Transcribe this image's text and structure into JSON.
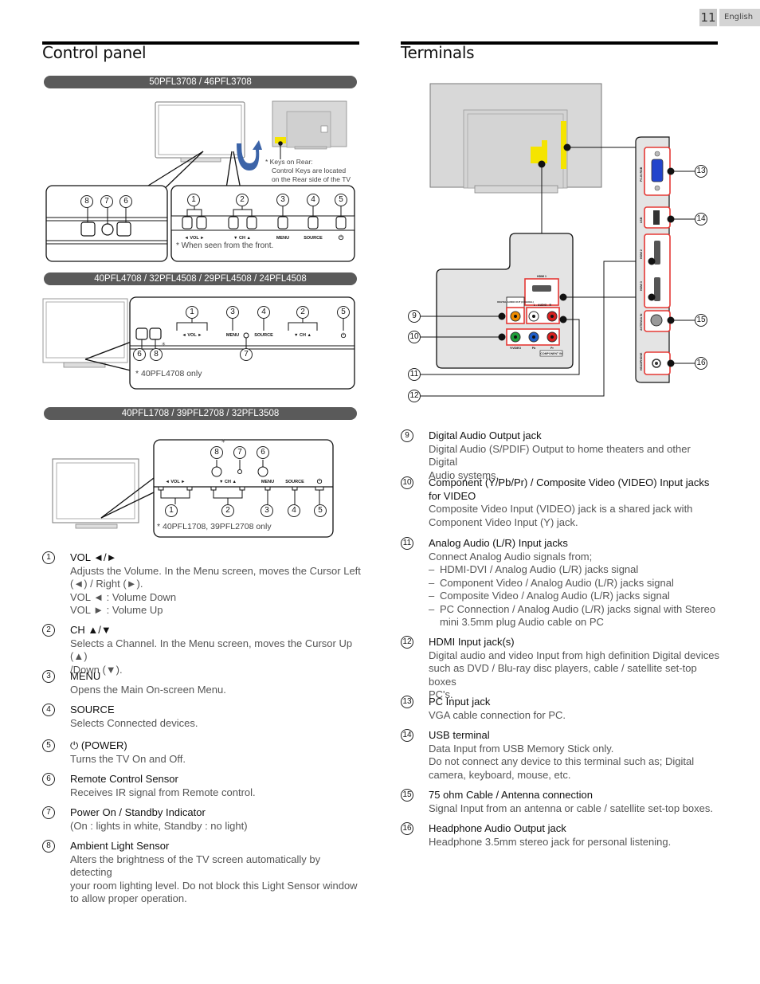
{
  "page": {
    "number": "11",
    "language": "English"
  },
  "control_panel": {
    "title": "Control panel",
    "models": [
      {
        "name": "50PFL3708 / 46PFL3708",
        "rear_note_title": "* Keys on Rear:",
        "rear_note_lines": [
          "Control Keys are located",
          "on the Rear side of the TV"
        ],
        "front_note": "* When seen from the front.",
        "button_labels": [
          "◄  VOL  ►",
          "▼  CH  ▲",
          "MENU",
          "SOURCE",
          "⏻"
        ],
        "callouts_left": [
          "8",
          "7",
          "6"
        ],
        "callouts_right": [
          "1",
          "2",
          "3",
          "4",
          "5"
        ]
      },
      {
        "name": "40PFL4708 / 32PFL4508 / 29PFL4508 / 24PFL4508",
        "note": "* 40PFL4708 only",
        "button_labels": [
          "◄  VOL  ►",
          "MENU",
          "SOURCE",
          "▼  CH  ▲",
          "⏻"
        ],
        "callouts_top": [
          "1",
          "3",
          "4",
          "2",
          "5"
        ],
        "callouts_bottom": [
          "6",
          "8",
          "7"
        ]
      },
      {
        "name": "40PFL1708 / 39PFL2708 / 32PFL3508",
        "note": "* 40PFL1708, 39PFL2708 only",
        "button_labels": [
          "◄  VOL  ►",
          "▼  CH  ▲",
          "MENU",
          "SOURCE",
          "⏻"
        ],
        "callouts_top": [
          "8",
          "7",
          "6"
        ],
        "callouts_bottom": [
          "1",
          "2",
          "3",
          "4",
          "5"
        ]
      }
    ],
    "items": [
      {
        "num": "1",
        "title": "VOL ◄/►",
        "lines": [
          "Adjusts the Volume. In the Menu screen, moves the Cursor Left",
          "(◄) / Right (►).",
          "VOL ◄ :  Volume Down",
          "VOL ► :  Volume Up"
        ]
      },
      {
        "num": "2",
        "title": "CH ▲/▼",
        "lines": [
          "Selects a Channel. In the Menu screen, moves the Cursor Up (▲)",
          "/Down (▼)."
        ]
      },
      {
        "num": "3",
        "title": "MENU",
        "lines": [
          "Opens the Main On-screen Menu."
        ]
      },
      {
        "num": "4",
        "title": "SOURCE",
        "lines": [
          "Selects Connected devices."
        ]
      },
      {
        "num": "5",
        "title": "⏻ (POWER)",
        "lines": [
          "Turns the TV On and Off."
        ]
      },
      {
        "num": "6",
        "title": "Remote Control Sensor",
        "lines": [
          "Receives IR signal from Remote control."
        ]
      },
      {
        "num": "7",
        "title": "Power On / Standby Indicator",
        "lines": [
          "(On : lights in white, Standby : no light)"
        ]
      },
      {
        "num": "8",
        "title": "Ambient Light Sensor",
        "lines": [
          "Alters the brightness of the TV screen automatically by detecting",
          "your room lighting level. Do not block this Light Sensor window",
          "to allow proper operation."
        ]
      }
    ]
  },
  "terminals": {
    "title": "Terminals",
    "diagram": {
      "rear_labels": [
        "HDMI 1",
        "DIGITAL AUDIO OUT (COAXIAL)",
        "L - AUDIO - R",
        "Y/VIDEO",
        "Pb",
        "Pr",
        "COMPONENT IN"
      ],
      "side_labels": [
        "PC-IN RGB",
        "USB",
        "HDMI 2",
        "HDMI 3",
        "ANTENNA IN",
        "HEADPHONE"
      ],
      "callouts": [
        "9",
        "10",
        "11",
        "12",
        "13",
        "14",
        "15",
        "16"
      ],
      "colors": {
        "highlight": "#e53935",
        "yellow": "#f5e400",
        "vga_blue": "#2244cc",
        "orange": "#f08c00",
        "green": "#1e9e3a",
        "blue": "#1e5ec8",
        "red": "#d61e1e"
      }
    },
    "items": [
      {
        "num": "9",
        "title": "Digital Audio Output jack",
        "lines": [
          "Digital Audio (S/PDIF) Output to home theaters and other Digital",
          "Audio systems."
        ]
      },
      {
        "num": "10",
        "title": "Component (Y/Pb/Pr) / Composite Video (VIDEO) Input jacks",
        "title2": "for VIDEO",
        "lines": [
          "Composite Video Input (VIDEO) jack is a shared jack with",
          "Component Video Input (Y) jack."
        ]
      },
      {
        "num": "11",
        "title": "Analog Audio (L/R) Input jacks",
        "lines": [
          "Connect Analog Audio signals from;"
        ],
        "bullets": [
          "HDMI-DVI / Analog Audio (L/R) jacks signal",
          "Component Video / Analog Audio (L/R) jacks signal",
          "Composite Video / Analog Audio (L/R) jacks signal",
          "PC Connection / Analog Audio (L/R) jacks signal with Stereo mini 3.5mm plug Audio cable on PC"
        ]
      },
      {
        "num": "12",
        "title": "HDMI Input jack(s)",
        "lines": [
          "Digital audio and video Input from high definition Digital devices",
          "such as DVD / Blu-ray disc players, cable / satellite set-top boxes",
          "PC's."
        ]
      },
      {
        "num": "13",
        "title": "PC Input jack",
        "lines": [
          "VGA cable connection for PC."
        ]
      },
      {
        "num": "14",
        "title": "USB terminal",
        "lines": [
          "Data Input from USB Memory Stick only.",
          "Do not connect any device to this terminal such as; Digital",
          "camera, keyboard, mouse, etc."
        ]
      },
      {
        "num": "15",
        "title": "75 ohm Cable / Antenna connection",
        "lines": [
          "Signal Input from an antenna or cable / satellite set-top boxes."
        ]
      },
      {
        "num": "16",
        "title": "Headphone Audio Output jack",
        "lines": [
          "Headphone 3.5mm stereo jack for personal listening."
        ]
      }
    ]
  }
}
